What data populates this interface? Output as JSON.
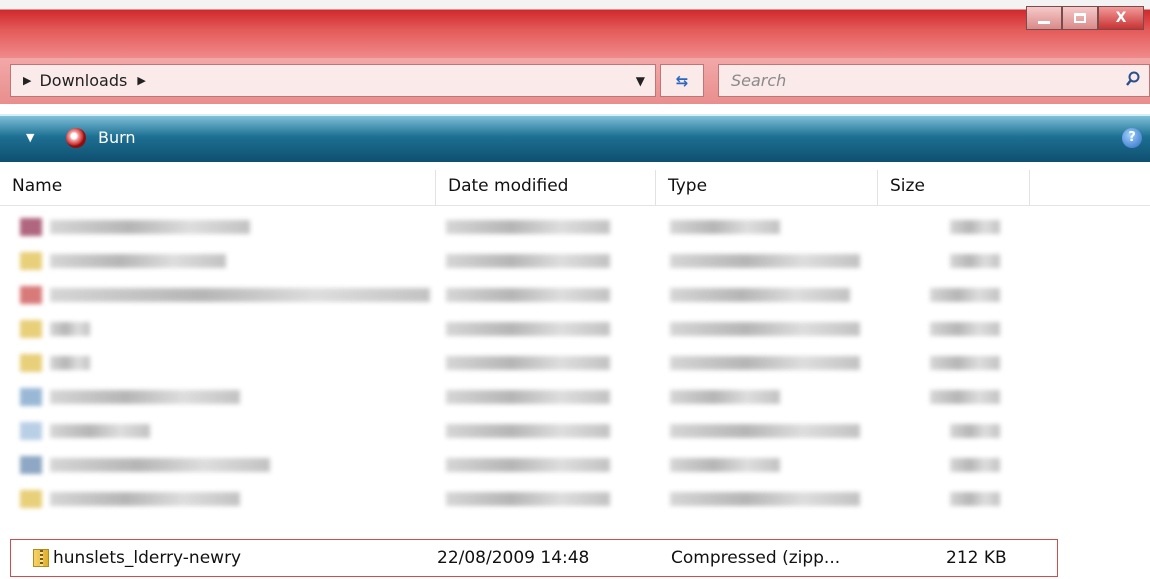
{
  "window": {
    "close_glyph": "X"
  },
  "address": {
    "breadcrumb": "Downloads",
    "search_placeholder": "Search"
  },
  "toolbar": {
    "burn_label": "Burn",
    "help_glyph": "?"
  },
  "columns": {
    "name": "Name",
    "date_modified": "Date modified",
    "type": "Type",
    "size": "Size"
  },
  "highlighted_file": {
    "name": "hunslets_lderry-newry",
    "date_modified": "22/08/2009 14:48",
    "type": "Compressed (zipp...",
    "size": "212 KB"
  },
  "colors": {
    "title_red": "#cf2a2c",
    "toolbar_teal": "#1d6f93",
    "highlight_border": "#d24c4c"
  }
}
